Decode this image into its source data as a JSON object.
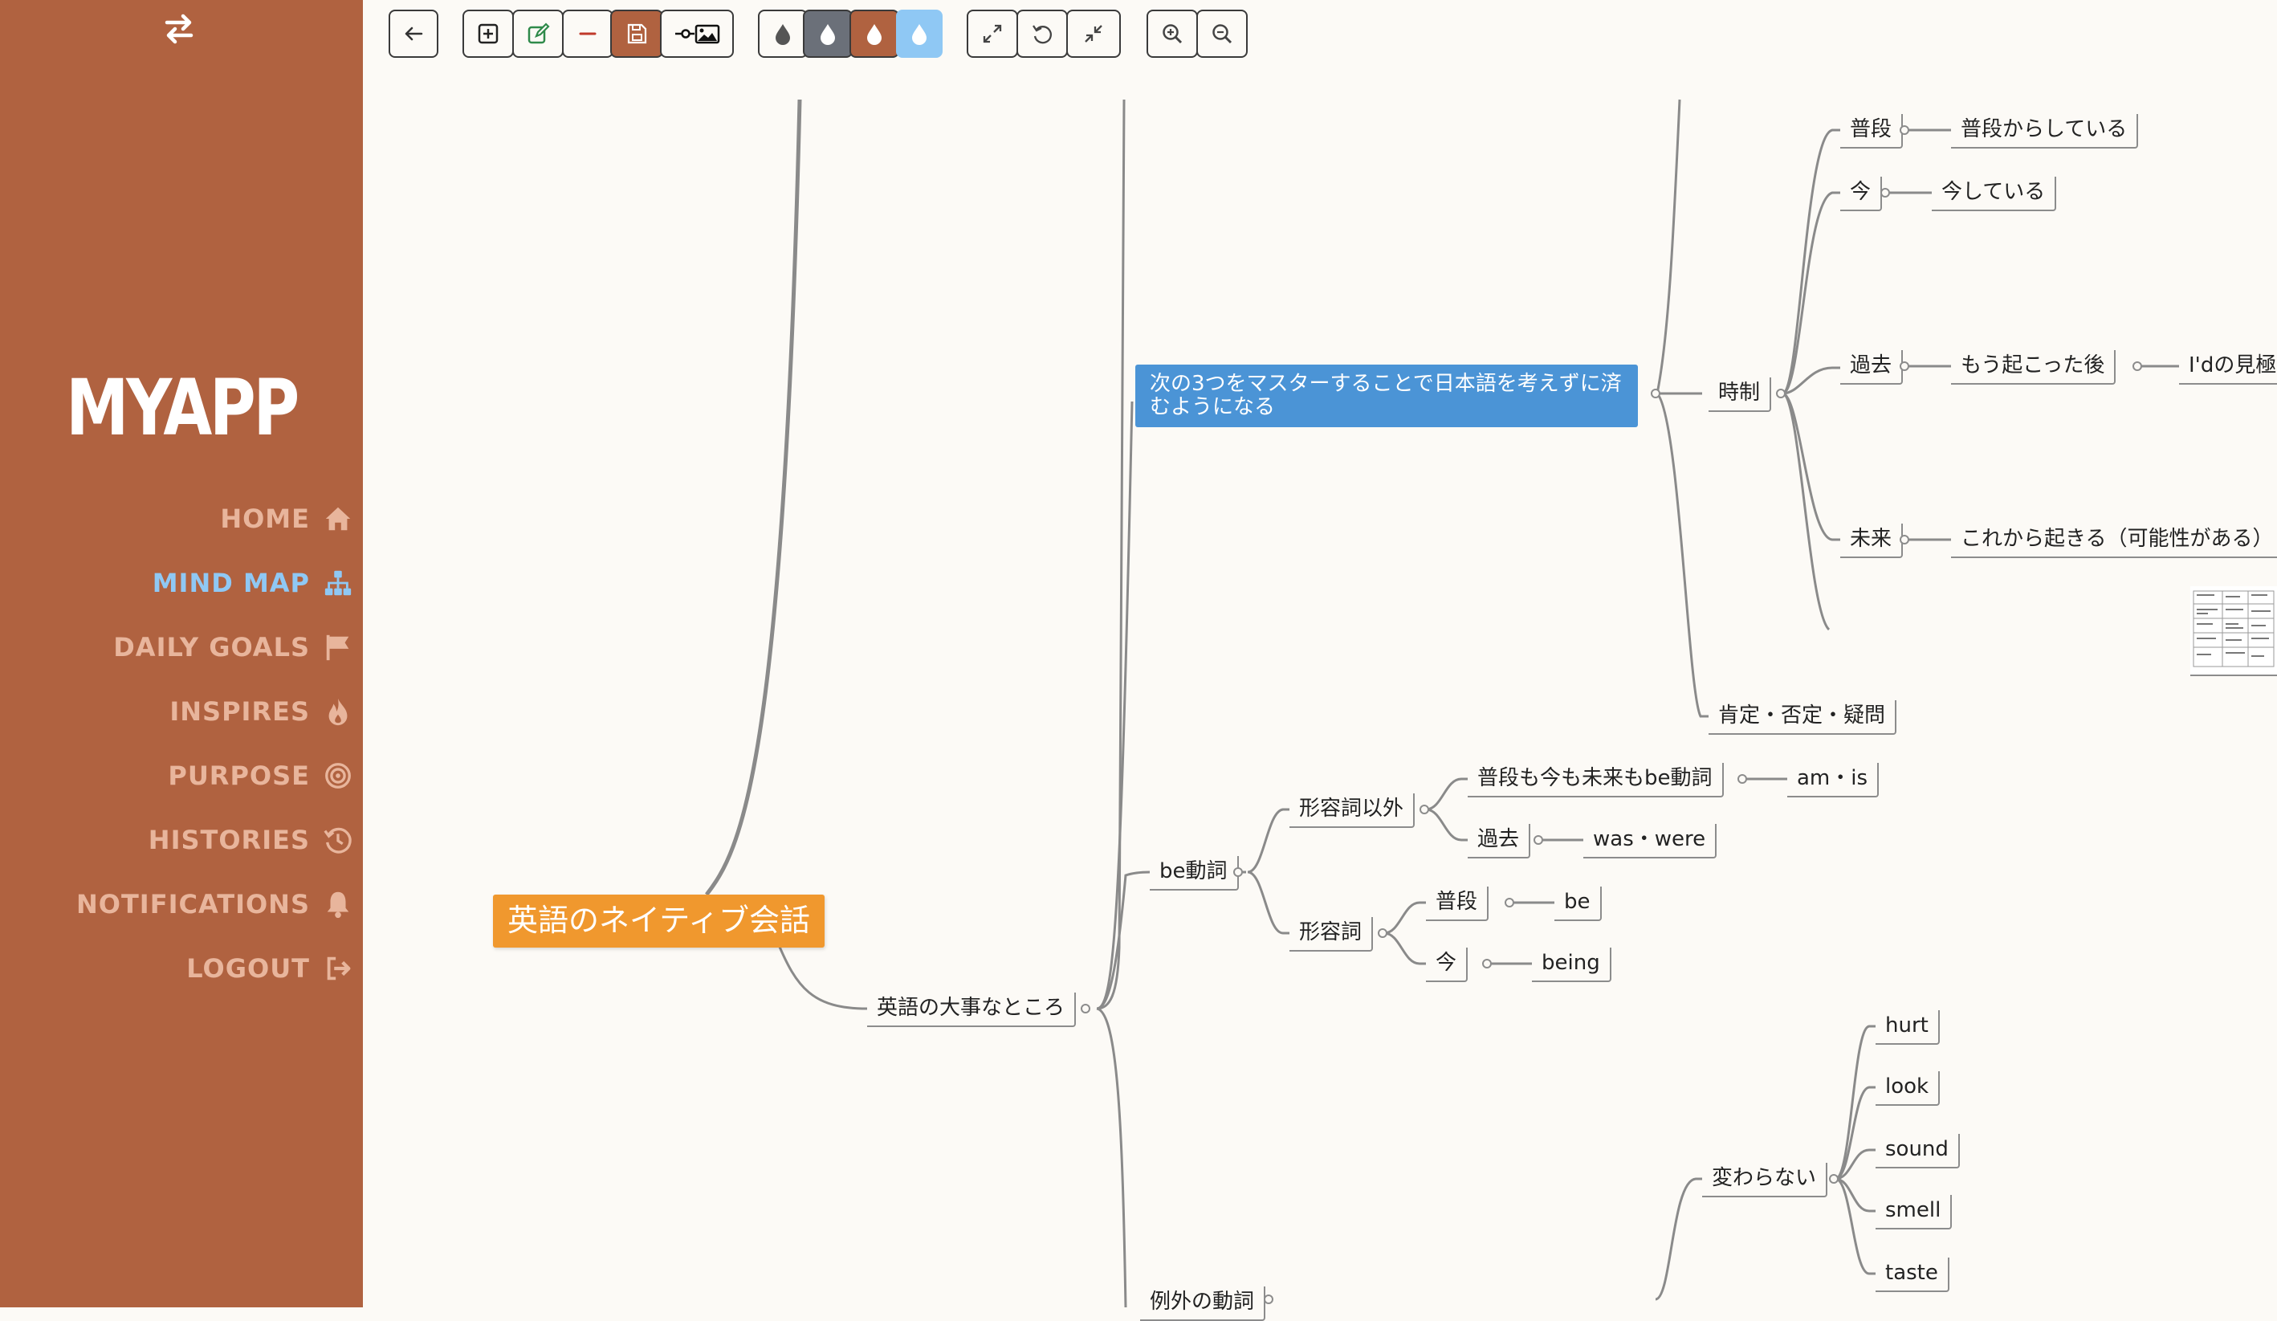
{
  "app": {
    "name": "MYAPP"
  },
  "sidebar": {
    "items": [
      {
        "label": "HOME",
        "icon": "home-icon"
      },
      {
        "label": "MIND MAP",
        "icon": "sitemap-icon",
        "active": true
      },
      {
        "label": "DAILY GOALS",
        "icon": "flag-icon"
      },
      {
        "label": "INSPIRES",
        "icon": "fire-icon"
      },
      {
        "label": "PURPOSE",
        "icon": "target-icon"
      },
      {
        "label": "HISTORIES",
        "icon": "history-icon"
      },
      {
        "label": "NOTIFICATIONS",
        "icon": "bell-icon"
      },
      {
        "label": "LOGOUT",
        "icon": "logout-icon"
      }
    ]
  },
  "toolbar": {
    "groups": [
      [
        "back-arrow-icon"
      ],
      [
        "add-node-icon",
        "edit-icon",
        "remove-icon",
        "save-icon",
        "insert-image-icon"
      ],
      [
        "theme-gray-light-icon",
        "theme-gray-dark-icon",
        "theme-orange-icon",
        "theme-blue-icon"
      ],
      [
        "expand-all-icon",
        "reset-icon",
        "collapse-all-icon"
      ],
      [
        "zoom-in-icon",
        "zoom-out-icon"
      ]
    ]
  },
  "colors": {
    "sidebar_bg": "#b06240",
    "sidebar_text": "#e8b59c",
    "active_nav": "#8fc8f4",
    "canvas_bg": "#fcfaf6",
    "root_node": "#f0982e",
    "selected_node": "#4b94d6",
    "edge": "#8a8a8a"
  },
  "mindmap": {
    "root": "英語のネイティブ会話",
    "key_points": "英語の大事なところ",
    "intro": "次の3つをマスターすることで日本語を考えずに済むようになる",
    "tense": "時制",
    "usually": "普段",
    "usually_doing": "普段からしている",
    "now": "今",
    "now_doing": "今している",
    "past": "過去",
    "after_happened": "もう起こった後",
    "id_truncated": "I'dの見極",
    "future": "未来",
    "future_desc": "これから起きる（可能性がある）",
    "affirm": "肯定・否定・疑問",
    "be_verb": "be動詞",
    "non_adjective": "形容詞以外",
    "always_be": "普段も今も未来もbe動詞",
    "am_is": "am・is",
    "past2": "過去",
    "was_were": "was・were",
    "adjective": "形容詞",
    "usually2": "普段",
    "be": "be",
    "now2": "今",
    "being": "being",
    "unchanged": "変わらない",
    "hurt": "hurt",
    "look": "look",
    "sound": "sound",
    "smell": "smell",
    "taste": "taste",
    "exception_verbs": "例外の動詞"
  }
}
